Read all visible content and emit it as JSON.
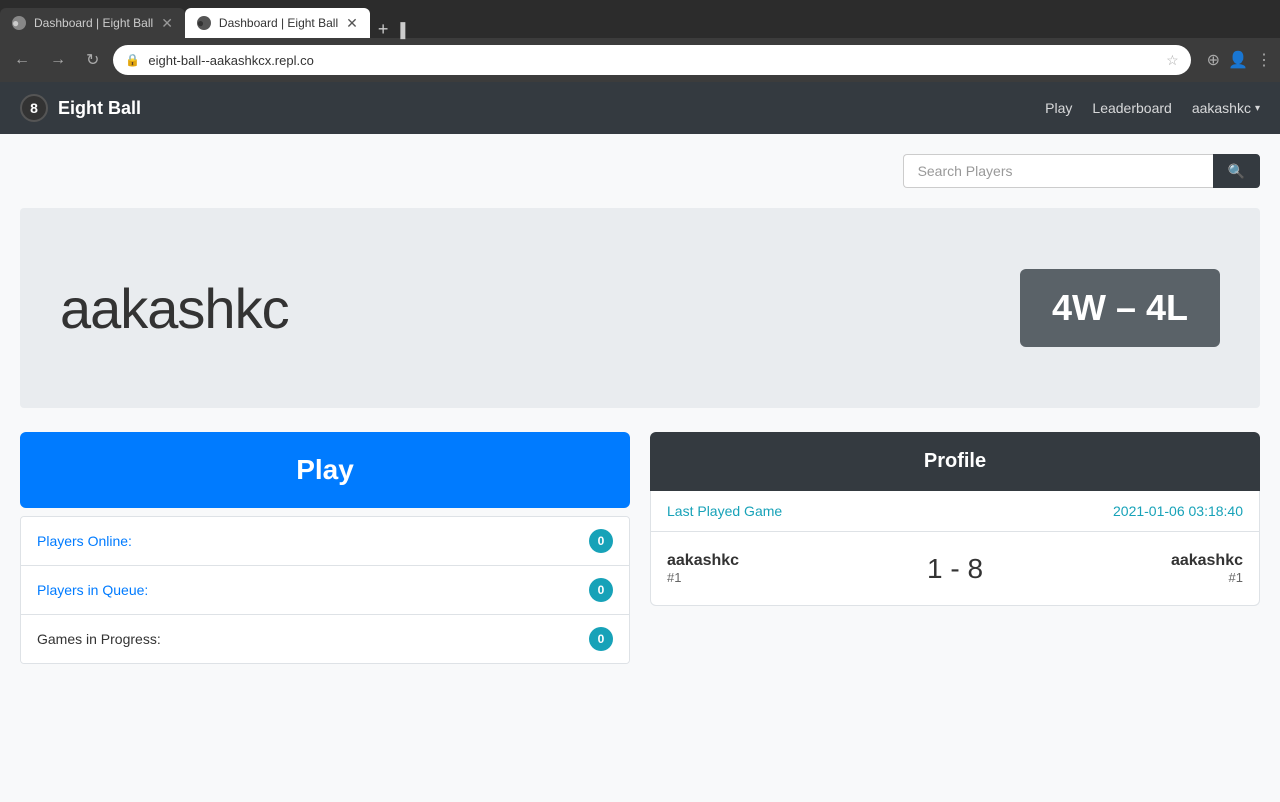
{
  "browser": {
    "tabs": [
      {
        "id": "tab1",
        "title": "Dashboard | Eight Ball",
        "active": false,
        "favicon": "8"
      },
      {
        "id": "tab2",
        "title": "Dashboard | Eight Ball",
        "active": true,
        "favicon": "8"
      }
    ],
    "new_tab_label": "+",
    "address": "eight-ball--aakashkcx.repl.co",
    "cursor": "▌"
  },
  "navbar": {
    "brand_icon": "8",
    "brand_name": "Eight Ball",
    "links": [
      "Play",
      "Leaderboard"
    ],
    "user": "aakashkc",
    "user_caret": "▾"
  },
  "search": {
    "placeholder": "Search Players",
    "button_icon": "🔍"
  },
  "hero": {
    "username": "aakashkc",
    "record": "4W – 4L"
  },
  "play": {
    "button_label": "Play",
    "stats": [
      {
        "label": "Players Online:",
        "value": "0"
      },
      {
        "label": "Players in Queue:",
        "value": "0"
      },
      {
        "label": "Games in Progress:",
        "value": "0"
      }
    ]
  },
  "profile": {
    "header": "Profile",
    "last_played_label": "Last Played Game",
    "last_played_time": "2021-01-06 03:18:40",
    "player1_name": "aakashkc",
    "player1_rank": "#1",
    "score": "1 - 8",
    "player2_name": "aakashkc",
    "player2_rank": "#1"
  }
}
